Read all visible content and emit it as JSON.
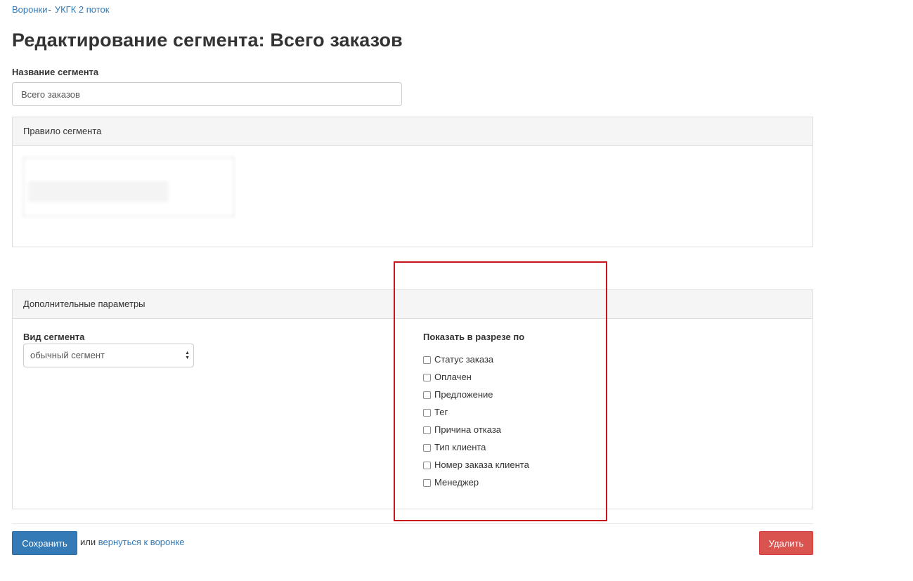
{
  "breadcrumb": {
    "link1": "Воронки",
    "separator": "-",
    "link2": "УКГК 2 поток"
  },
  "page_title": "Редактирование сегмента: Всего заказов",
  "segment_name": {
    "label": "Название сегмента",
    "value": "Всего заказов"
  },
  "rule_panel": {
    "heading": "Правило сегмента"
  },
  "params_panel": {
    "heading": "Дополнительные параметры",
    "view_label": "Вид сегмента",
    "view_selected": "обычный сегмент",
    "show_label": "Показать в разрезе по",
    "checkboxes": [
      {
        "label": "Статус заказа",
        "checked": false
      },
      {
        "label": "Оплачен",
        "checked": false
      },
      {
        "label": "Предложение",
        "checked": false
      },
      {
        "label": "Тег",
        "checked": false
      },
      {
        "label": "Причина отказа",
        "checked": false
      },
      {
        "label": "Тип клиента",
        "checked": false
      },
      {
        "label": "Номер заказа клиента",
        "checked": false
      },
      {
        "label": "Менеджер",
        "checked": false
      }
    ]
  },
  "footer": {
    "save_label": "Сохранить",
    "or_text": "или",
    "back_link": "вернуться к воронке",
    "delete_label": "Удалить"
  },
  "colors": {
    "primary": "#337ab7",
    "danger": "#d9534f",
    "highlight": "#c8141a"
  }
}
